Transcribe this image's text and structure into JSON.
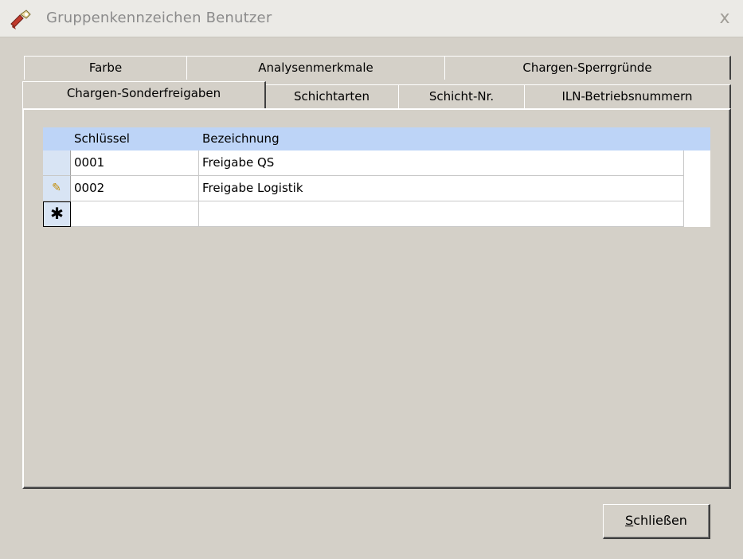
{
  "window": {
    "title": "Gruppenkennzeichen Benutzer",
    "close_glyph": "x"
  },
  "tabs": {
    "row1": [
      "Farbe",
      "Analysenmerkmale",
      "Chargen-Sperrgründe"
    ],
    "row2": [
      "Chargen-Sonderfreigaben",
      "Schichtarten",
      "Schicht-Nr.",
      "ILN-Betriebsnummern"
    ],
    "active": "Chargen-Sonderfreigaben"
  },
  "grid": {
    "columns": [
      "Schlüssel",
      "Bezeichnung"
    ],
    "rows": [
      {
        "key": "0001",
        "name": "Freigabe QS"
      },
      {
        "key": "0002",
        "name": "Freigabe Logistik"
      }
    ],
    "new_row_marker": "✱",
    "edit_marker": "✎"
  },
  "buttons": {
    "close_prefix": "S",
    "close_rest": "chließen"
  },
  "colors": {
    "header_bg": "#bdd4f7",
    "dialog_bg": "#d4d0c8"
  }
}
